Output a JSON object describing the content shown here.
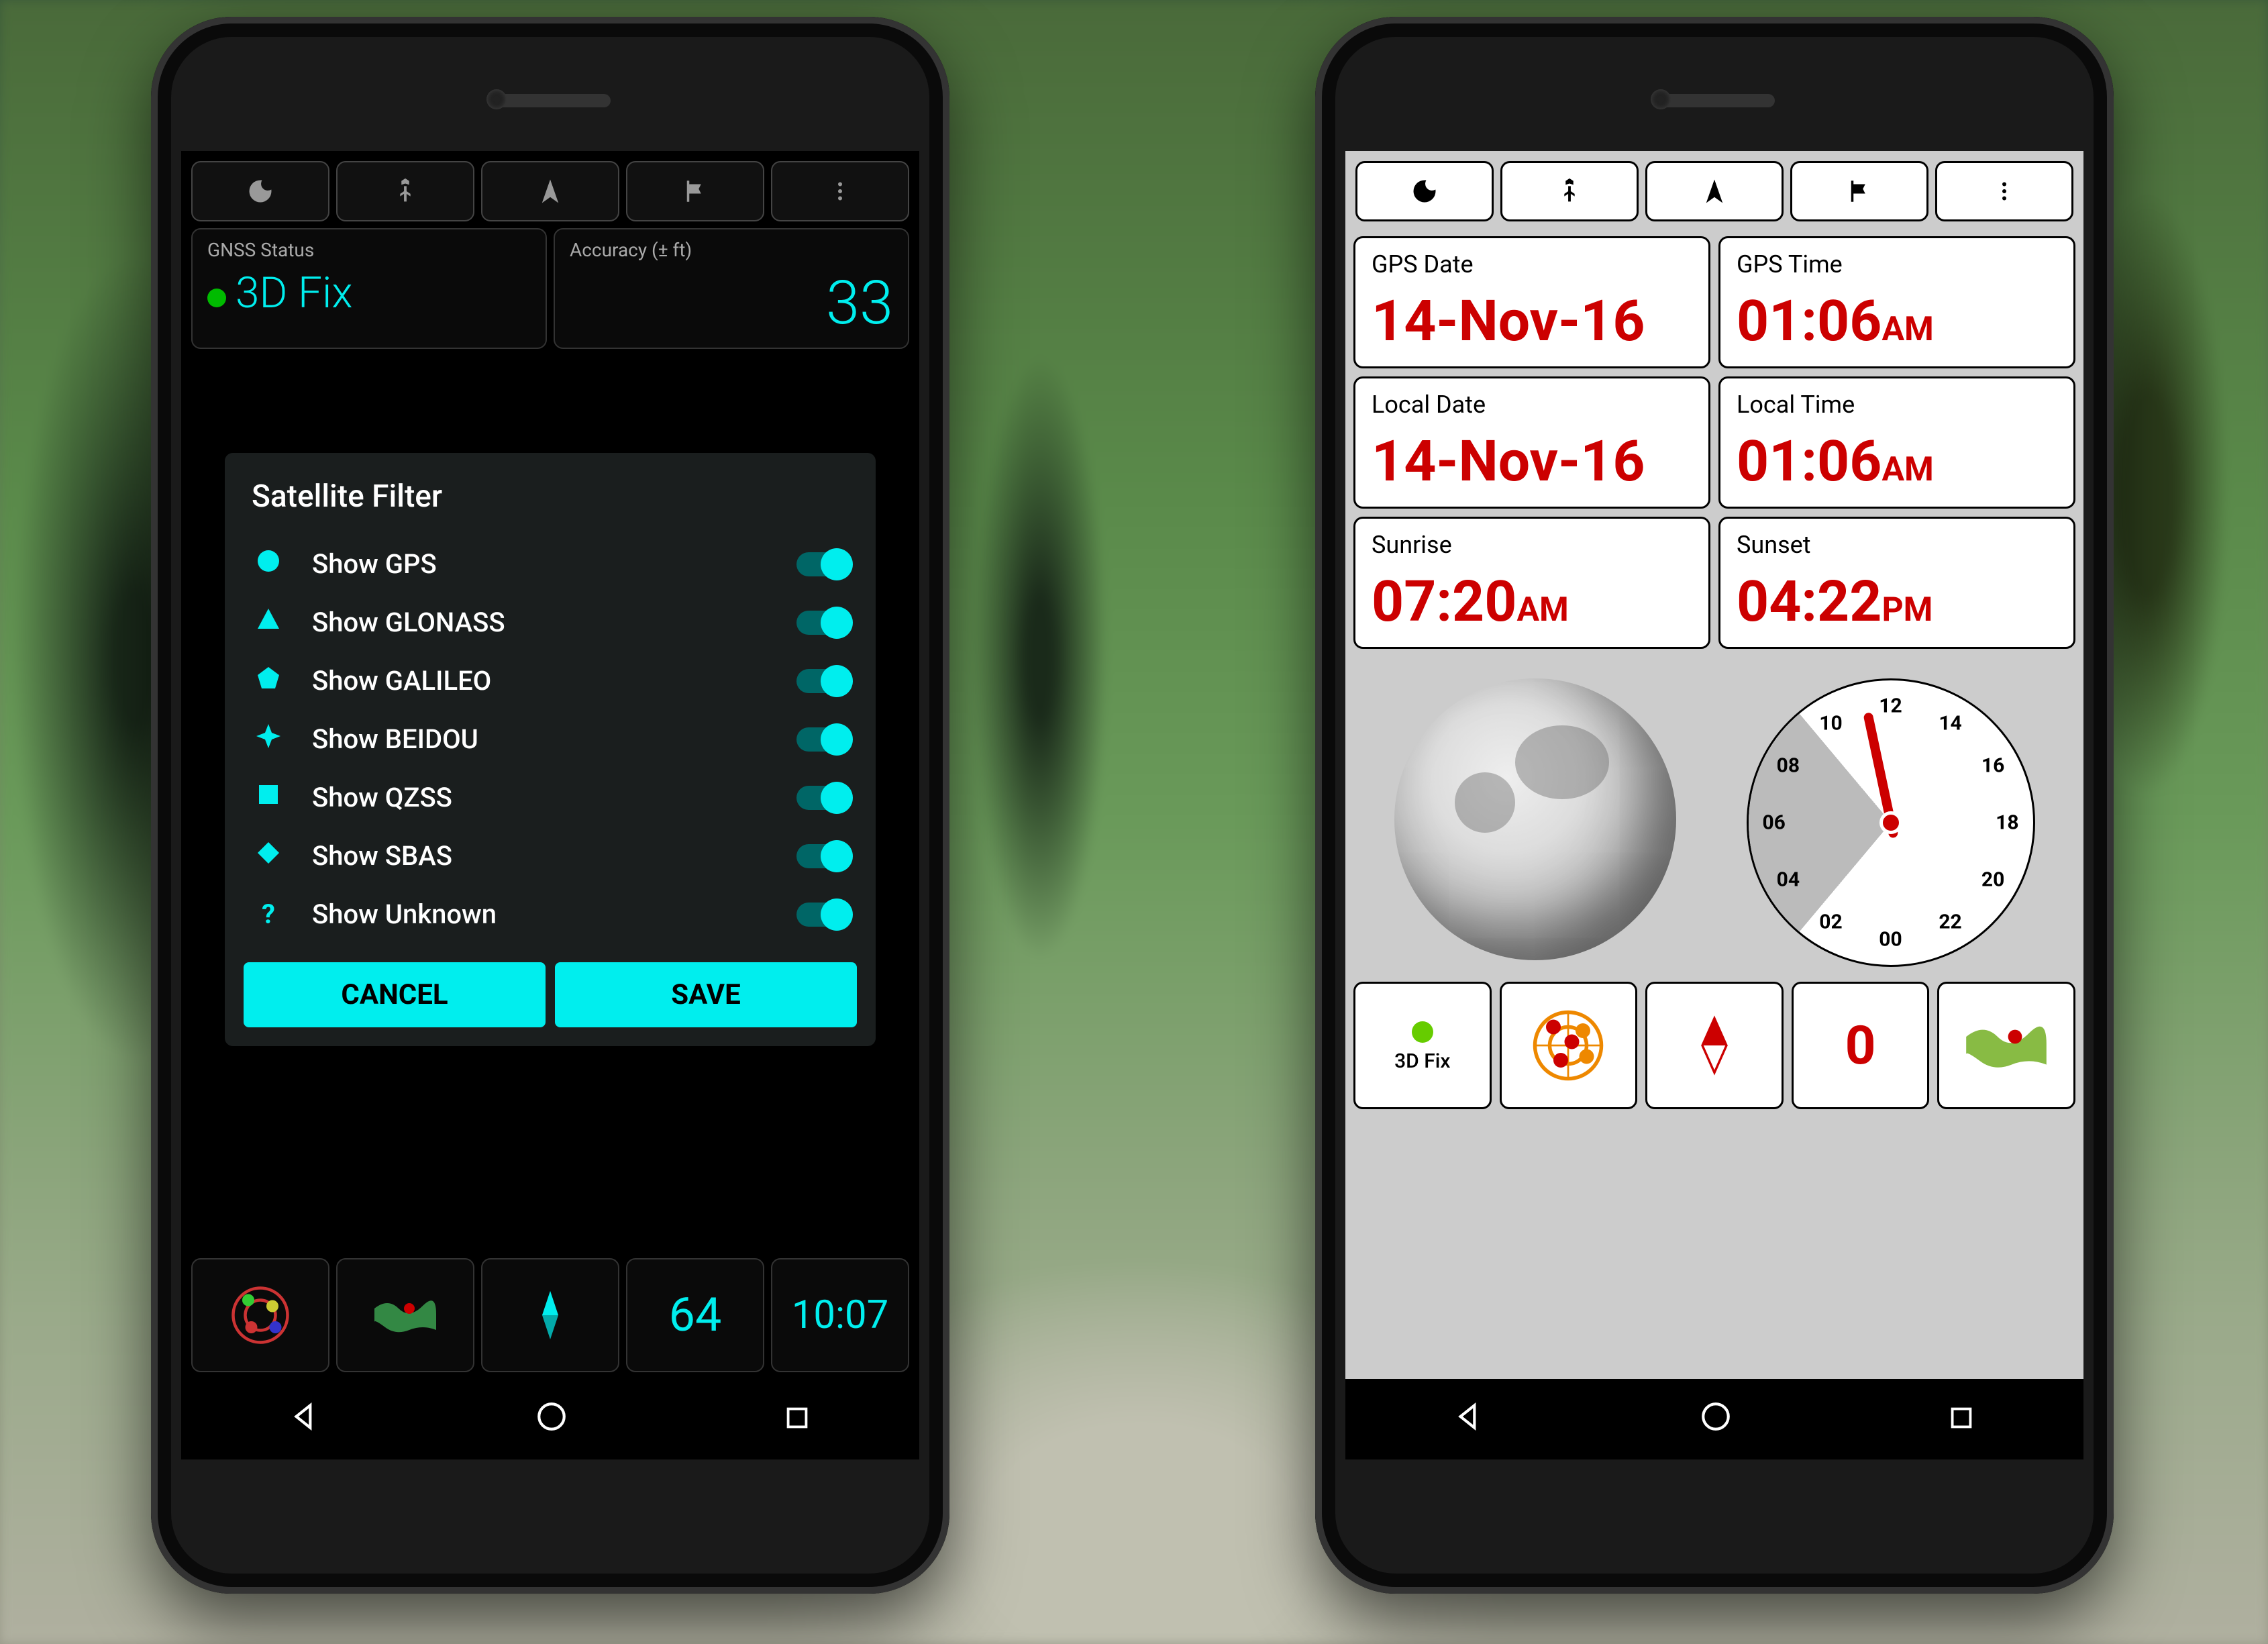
{
  "dark": {
    "toolbar_icons": [
      "moon",
      "person-flag",
      "nav-arrow",
      "flag",
      "more"
    ],
    "gnss_status_label": "GNSS Status",
    "gnss_status_value": "3D Fix",
    "accuracy_label": "Accuracy (± ft)",
    "accuracy_value": "33",
    "dialog_title": "Satellite Filter",
    "filters": [
      {
        "icon": "circle",
        "label": "Show GPS",
        "on": true
      },
      {
        "icon": "triangle",
        "label": "Show GLONASS",
        "on": true
      },
      {
        "icon": "pentagon",
        "label": "Show GALILEO",
        "on": true
      },
      {
        "icon": "star4",
        "label": "Show BEIDOU",
        "on": true
      },
      {
        "icon": "square",
        "label": "Show QZSS",
        "on": true
      },
      {
        "icon": "diamond",
        "label": "Show SBAS",
        "on": true
      },
      {
        "icon": "question",
        "label": "Show Unknown",
        "on": true
      }
    ],
    "cancel_label": "CANCEL",
    "save_label": "SAVE",
    "bottom_count": "64",
    "bottom_time": "10:07"
  },
  "light": {
    "toolbar_icons": [
      "moon",
      "person-flag",
      "nav-arrow",
      "flag",
      "more"
    ],
    "cards": [
      {
        "label": "GPS Date",
        "value": "14-Nov-16",
        "ampm": ""
      },
      {
        "label": "GPS Time",
        "value": "01:06",
        "ampm": "AM"
      },
      {
        "label": "Local Date",
        "value": "14-Nov-16",
        "ampm": ""
      },
      {
        "label": "Local Time",
        "value": "01:06",
        "ampm": "AM"
      },
      {
        "label": "Sunrise",
        "value": "07:20",
        "ampm": "AM"
      },
      {
        "label": "Sunset",
        "value": "04:22",
        "ampm": "PM"
      }
    ],
    "clock_hours": [
      "12",
      "14",
      "16",
      "18",
      "20",
      "22",
      "00",
      "02",
      "04",
      "06",
      "08",
      "10"
    ],
    "fix_label": "3D Fix",
    "compass_heading": "0"
  }
}
